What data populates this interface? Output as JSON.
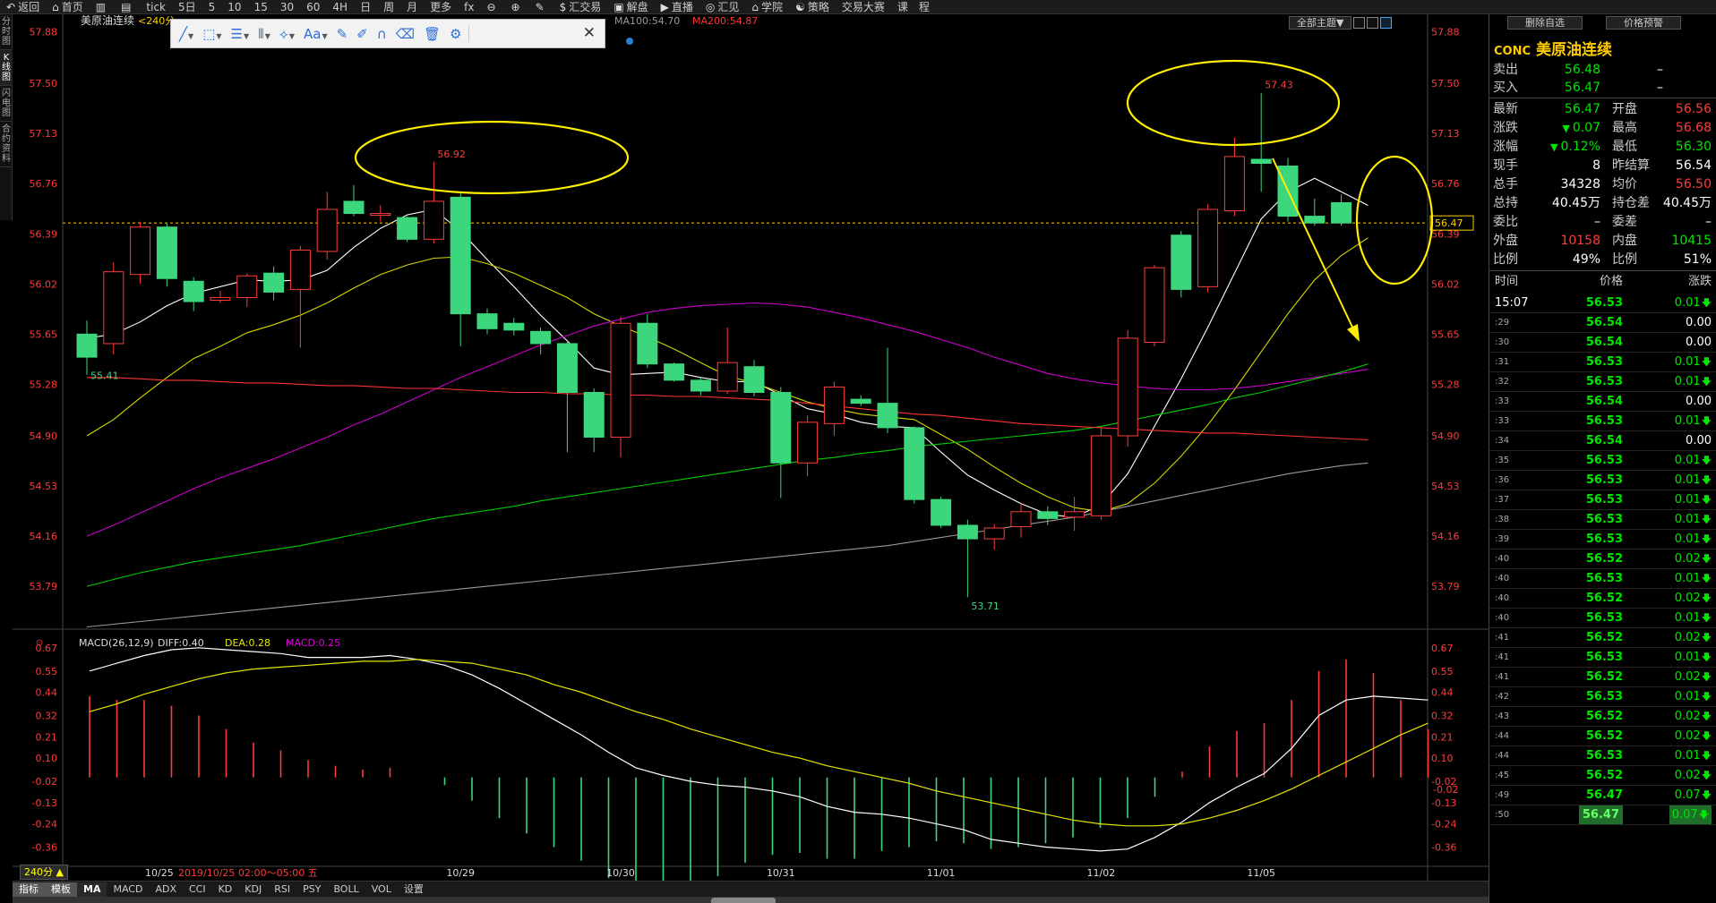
{
  "topbar": {
    "items": [
      "返回",
      "首页",
      "",
      "",
      "tick",
      "5日",
      "5",
      "10",
      "15",
      "30",
      "60",
      "4H",
      "日",
      "周",
      "月",
      "更多",
      "fx",
      "",
      "",
      "",
      "汇交易",
      "解盘",
      "直播",
      "汇见",
      "学院",
      "策略",
      "交易大赛",
      "课　程"
    ]
  },
  "left_tabs": [
    "分时图",
    "K线图",
    "闪电图",
    "合约资料"
  ],
  "chart_header": {
    "name": "美原油连续",
    "period_suffix": "<240分",
    "ma100": "MA100:54.70",
    "ma200": "MA200:54.87"
  },
  "topright": {
    "theme_button": "全部主题▼"
  },
  "macd_header": {
    "title": "MACD(26,12,9)",
    "diff": "DIFF:0.40",
    "dea": "DEA:0.28",
    "macd": "MACD:0.25"
  },
  "status_bar": {
    "period": "240分 ▲",
    "date_info": "2019/10/25 02:00～05:00 五",
    "first_date": "10/25"
  },
  "bottom_tabs": [
    "指标",
    "模板",
    "MA",
    "MACD",
    "ADX",
    "CCI",
    "KD",
    "KDJ",
    "RSI",
    "PSY",
    "BOLL",
    "VOL",
    "设置"
  ],
  "price_box": "56.47",
  "colors": {
    "up": "#ff3b3b",
    "down": "#3cd67d",
    "yellow_annot": "#ffee00",
    "ma_white": "#ffffff",
    "ma_yellow": "#d6d600",
    "ma_magenta": "#cc00cc",
    "ma_green": "#00cc00",
    "ma_red": "#ff3333",
    "ma_gray": "#999999"
  },
  "chart_data": [
    {
      "type": "candlestick",
      "title": "美原油连续",
      "y_ticks": [
        57.88,
        57.5,
        57.13,
        56.76,
        56.39,
        56.02,
        55.65,
        55.28,
        54.9,
        54.53,
        54.16,
        53.79
      ],
      "ylim": [
        53.52,
        57.93
      ],
      "x_date_labels": [
        "10/25",
        "10/29",
        "10/30",
        "10/31",
        "11/01",
        "11/02",
        "11/05"
      ],
      "x_label_bar_index": [
        0,
        14,
        20,
        26,
        32,
        38,
        44
      ],
      "current_price": 56.47,
      "annotations": [
        {
          "text": "56.92",
          "bar": 13,
          "value": 56.92
        },
        {
          "text": "57.43",
          "bar": 44,
          "value": 57.43
        },
        {
          "text": "53.71",
          "bar": 33,
          "value": 53.71
        },
        {
          "text": "55.41",
          "bar": 0,
          "value": 55.41
        }
      ],
      "candles": [
        [
          55.65,
          55.48,
          55.75,
          55.35
        ],
        [
          55.58,
          56.11,
          56.18,
          55.5
        ],
        [
          56.09,
          56.44,
          56.48,
          56.02
        ],
        [
          56.44,
          56.06,
          56.47,
          56.0
        ],
        [
          56.04,
          55.89,
          56.07,
          55.82
        ],
        [
          55.9,
          55.92,
          55.97,
          55.88
        ],
        [
          55.92,
          56.08,
          56.1,
          55.85
        ],
        [
          56.1,
          55.96,
          56.15,
          55.9
        ],
        [
          55.98,
          56.27,
          56.3,
          55.55
        ],
        [
          56.26,
          56.57,
          56.7,
          56.2
        ],
        [
          56.63,
          56.54,
          56.75,
          56.52
        ],
        [
          56.54,
          56.54,
          56.6,
          56.48
        ],
        [
          56.51,
          56.35,
          56.52,
          56.33
        ],
        [
          56.35,
          56.63,
          56.92,
          56.32
        ],
        [
          56.66,
          55.8,
          56.7,
          55.56
        ],
        [
          55.8,
          55.69,
          55.84,
          55.65
        ],
        [
          55.73,
          55.68,
          55.77,
          55.64
        ],
        [
          55.67,
          55.58,
          55.7,
          55.5
        ],
        [
          55.58,
          55.22,
          55.6,
          54.78
        ],
        [
          55.22,
          54.89,
          55.25,
          54.78
        ],
        [
          54.89,
          55.73,
          55.78,
          54.74
        ],
        [
          55.73,
          55.43,
          55.8,
          55.4
        ],
        [
          55.43,
          55.31,
          55.44,
          55.3
        ],
        [
          55.31,
          55.23,
          55.33,
          55.2
        ],
        [
          55.23,
          55.44,
          55.7,
          55.21
        ],
        [
          55.41,
          55.22,
          55.46,
          55.19
        ],
        [
          55.22,
          54.7,
          55.26,
          54.44
        ],
        [
          54.7,
          55.0,
          55.05,
          54.6
        ],
        [
          54.99,
          55.26,
          55.3,
          54.9
        ],
        [
          55.17,
          55.14,
          55.2,
          55.12
        ],
        [
          55.14,
          54.96,
          55.55,
          54.92
        ],
        [
          54.96,
          54.43,
          54.97,
          54.4
        ],
        [
          54.43,
          54.24,
          54.45,
          54.22
        ],
        [
          54.24,
          54.14,
          54.28,
          53.71
        ],
        [
          54.14,
          54.22,
          54.25,
          54.06
        ],
        [
          54.23,
          54.34,
          54.4,
          54.15
        ],
        [
          54.34,
          54.29,
          54.38,
          54.24
        ],
        [
          54.3,
          54.34,
          54.45,
          54.2
        ],
        [
          54.31,
          54.9,
          54.96,
          54.28
        ],
        [
          54.9,
          55.62,
          55.68,
          54.82
        ],
        [
          55.59,
          56.14,
          56.16,
          55.56
        ],
        [
          56.38,
          55.98,
          56.41,
          55.92
        ],
        [
          56.0,
          56.57,
          56.61,
          55.96
        ],
        [
          56.56,
          56.96,
          57.1,
          56.52
        ],
        [
          56.94,
          56.91,
          57.43,
          56.7
        ],
        [
          56.89,
          56.52,
          56.95,
          56.48
        ],
        [
          56.52,
          56.47,
          56.65,
          56.45
        ],
        [
          56.62,
          56.47,
          56.68,
          56.45
        ]
      ],
      "ma_series": [
        {
          "values": [
            55.62,
            55.65,
            55.74,
            55.86,
            55.95,
            56.0,
            56.05,
            56.04,
            56.05,
            56.12,
            56.29,
            56.43,
            56.53,
            56.57,
            56.41,
            56.2,
            56.0,
            55.79,
            55.6,
            55.4,
            55.35,
            55.36,
            55.37,
            55.33,
            55.3,
            55.3,
            55.2,
            55.1,
            55.06,
            55.0,
            54.97,
            54.96,
            54.78,
            54.61,
            54.5,
            54.4,
            54.32,
            54.3,
            54.39,
            54.62,
            54.97,
            55.32,
            55.7,
            56.1,
            56.5,
            56.7,
            56.8,
            56.7,
            56.6
          ]
        },
        {
          "values": [
            54.9,
            55.02,
            55.18,
            55.33,
            55.47,
            55.56,
            55.66,
            55.72,
            55.79,
            55.88,
            55.99,
            56.09,
            56.16,
            56.21,
            56.22,
            56.17,
            56.1,
            56.01,
            55.92,
            55.8,
            55.71,
            55.63,
            55.54,
            55.44,
            55.34,
            55.29,
            55.22,
            55.15,
            55.1,
            55.06,
            55.04,
            55.02,
            54.91,
            54.8,
            54.67,
            54.55,
            54.45,
            54.37,
            54.34,
            54.4,
            54.55,
            54.75,
            54.98,
            55.24,
            55.52,
            55.8,
            56.05,
            56.23,
            56.36
          ]
        },
        {
          "values": [
            54.16,
            54.24,
            54.33,
            54.42,
            54.51,
            54.59,
            54.66,
            54.73,
            54.81,
            54.89,
            54.98,
            55.06,
            55.15,
            55.24,
            55.33,
            55.41,
            55.49,
            55.57,
            55.64,
            55.71,
            55.76,
            55.81,
            55.84,
            55.86,
            55.87,
            55.88,
            55.87,
            55.85,
            55.81,
            55.77,
            55.72,
            55.67,
            55.61,
            55.55,
            55.48,
            55.42,
            55.36,
            55.32,
            55.29,
            55.27,
            55.25,
            55.24,
            55.24,
            55.25,
            55.27,
            55.3,
            55.33,
            55.36,
            55.39
          ]
        },
        {
          "values": [
            53.79,
            53.84,
            53.89,
            53.93,
            53.97,
            54.0,
            54.03,
            54.06,
            54.09,
            54.13,
            54.17,
            54.21,
            54.25,
            54.29,
            54.32,
            54.35,
            54.38,
            54.42,
            54.45,
            54.48,
            54.51,
            54.54,
            54.57,
            54.6,
            54.63,
            54.66,
            54.69,
            54.72,
            54.74,
            54.77,
            54.79,
            54.82,
            54.84,
            54.86,
            54.88,
            54.9,
            54.92,
            54.94,
            54.97,
            55.01,
            55.05,
            55.09,
            55.13,
            55.18,
            55.22,
            55.27,
            55.32,
            55.37,
            55.43
          ]
        },
        {
          "values": [
            55.33,
            55.33,
            55.32,
            55.31,
            55.31,
            55.3,
            55.29,
            55.29,
            55.28,
            55.27,
            55.27,
            55.26,
            55.25,
            55.25,
            55.24,
            55.23,
            55.22,
            55.22,
            55.21,
            55.21,
            55.2,
            55.2,
            55.19,
            55.19,
            55.18,
            55.17,
            55.16,
            55.14,
            55.12,
            55.1,
            55.08,
            55.06,
            55.05,
            55.03,
            55.01,
            54.99,
            54.98,
            54.97,
            54.96,
            54.95,
            54.94,
            54.93,
            54.92,
            54.92,
            54.91,
            54.9,
            54.89,
            54.88,
            54.87
          ]
        },
        {
          "values": [
            53.49,
            53.51,
            53.53,
            53.55,
            53.57,
            53.59,
            53.61,
            53.63,
            53.65,
            53.67,
            53.69,
            53.71,
            53.73,
            53.75,
            53.77,
            53.79,
            53.81,
            53.83,
            53.85,
            53.87,
            53.89,
            53.91,
            53.93,
            53.95,
            53.97,
            53.99,
            54.01,
            54.03,
            54.05,
            54.07,
            54.09,
            54.12,
            54.15,
            54.18,
            54.21,
            54.24,
            54.27,
            54.3,
            54.34,
            54.38,
            54.42,
            54.46,
            54.5,
            54.54,
            54.58,
            54.62,
            54.65,
            54.68,
            54.7
          ]
        }
      ]
    },
    {
      "type": "macd",
      "title": "MACD(26,12,9)",
      "y_ticks": [
        0.67,
        0.55,
        0.44,
        0.32,
        0.21,
        0.1,
        -0.02,
        -0.13,
        -0.24,
        -0.36
      ],
      "ylim": [
        -0.45,
        0.72
      ],
      "right_current_label": "-0.02",
      "diff": [
        0.55,
        0.59,
        0.63,
        0.66,
        0.67,
        0.66,
        0.65,
        0.64,
        0.62,
        0.62,
        0.62,
        0.63,
        0.61,
        0.58,
        0.53,
        0.46,
        0.38,
        0.3,
        0.22,
        0.13,
        0.05,
        0.01,
        -0.02,
        -0.04,
        -0.05,
        -0.07,
        -0.1,
        -0.15,
        -0.18,
        -0.19,
        -0.21,
        -0.24,
        -0.27,
        -0.32,
        -0.34,
        -0.36,
        -0.37,
        -0.38,
        -0.37,
        -0.31,
        -0.23,
        -0.13,
        -0.05,
        0.02,
        0.15,
        0.32,
        0.4,
        0.42,
        0.41,
        0.4
      ],
      "dea": [
        0.34,
        0.38,
        0.43,
        0.47,
        0.51,
        0.54,
        0.56,
        0.57,
        0.58,
        0.59,
        0.6,
        0.6,
        0.61,
        0.6,
        0.59,
        0.56,
        0.53,
        0.48,
        0.44,
        0.39,
        0.34,
        0.3,
        0.25,
        0.21,
        0.17,
        0.13,
        0.1,
        0.06,
        0.03,
        0.0,
        -0.03,
        -0.07,
        -0.1,
        -0.13,
        -0.16,
        -0.19,
        -0.22,
        -0.24,
        -0.25,
        -0.25,
        -0.24,
        -0.21,
        -0.17,
        -0.12,
        -0.06,
        0.01,
        0.08,
        0.15,
        0.22,
        0.28
      ],
      "macd_hist": [
        0.42,
        0.4,
        0.4,
        0.37,
        0.32,
        0.25,
        0.18,
        0.14,
        0.09,
        0.06,
        0.04,
        0.05,
        0.0,
        -0.04,
        -0.12,
        -0.21,
        -0.29,
        -0.36,
        -0.43,
        -0.52,
        -0.58,
        -0.58,
        -0.56,
        -0.51,
        -0.44,
        -0.4,
        -0.39,
        -0.42,
        -0.42,
        -0.38,
        -0.36,
        -0.33,
        -0.34,
        -0.37,
        -0.36,
        -0.34,
        -0.31,
        -0.26,
        -0.21,
        -0.1,
        0.03,
        0.16,
        0.24,
        0.28,
        0.4,
        0.55,
        0.61,
        0.54,
        0.4,
        0.25
      ]
    }
  ],
  "panel": {
    "code": "CONC",
    "name": "美原油连续",
    "buttons": [
      "删除自选",
      "价格预警"
    ],
    "bid_ask": [
      {
        "label": "卖出",
        "value": "56.48",
        "extra": "–"
      },
      {
        "label": "买入",
        "value": "56.47",
        "extra": "–"
      }
    ],
    "stats": [
      {
        "l1": "最新",
        "v1": "56.47",
        "c1": "green",
        "l2": "开盘",
        "v2": "56.56",
        "c2": "red"
      },
      {
        "l1": "涨跌",
        "v1": "0.07",
        "c1": "green",
        "l2": "最高",
        "v2": "56.68",
        "c2": "red"
      },
      {
        "l1": "涨幅",
        "v1": "0.12%",
        "c1": "green",
        "l2": "最低",
        "v2": "56.30",
        "c2": "green"
      },
      {
        "l1": "现手",
        "v1": "8",
        "c1": "white",
        "l2": "昨结算",
        "v2": "56.54",
        "c2": "white"
      },
      {
        "l1": "总手",
        "v1": "34328",
        "c1": "white",
        "l2": "均价",
        "v2": "56.50",
        "c2": "red"
      },
      {
        "l1": "总持",
        "v1": "40.45万",
        "c1": "white",
        "l2": "持仓差",
        "v2": "40.45万",
        "c2": "white"
      },
      {
        "l1": "委比",
        "v1": "–",
        "c1": "white",
        "l2": "委差",
        "v2": "–",
        "c2": "white"
      },
      {
        "l1": "外盘",
        "v1": "10158",
        "c1": "red",
        "l2": "内盘",
        "v2": "10415",
        "c2": "green"
      },
      {
        "l1": "比例",
        "v1": "49%",
        "c1": "white",
        "l2": "比例",
        "v2": "51%",
        "c2": "white"
      }
    ],
    "tick_header": {
      "time": "时间",
      "price": "价格",
      "change": "涨跌"
    },
    "ticks": [
      {
        "t": "15:07",
        "p": "56.53",
        "c": "0.01",
        "dir": "up"
      },
      {
        "t": ":29",
        "p": "56.54",
        "c": "0.00",
        "dir": "flat"
      },
      {
        "t": ":30",
        "p": "56.54",
        "c": "0.00",
        "dir": "flat"
      },
      {
        "t": ":31",
        "p": "56.53",
        "c": "0.01",
        "dir": "up"
      },
      {
        "t": ":32",
        "p": "56.53",
        "c": "0.01",
        "dir": "up"
      },
      {
        "t": ":33",
        "p": "56.54",
        "c": "0.00",
        "dir": "flat"
      },
      {
        "t": ":33",
        "p": "56.53",
        "c": "0.01",
        "dir": "up"
      },
      {
        "t": ":34",
        "p": "56.54",
        "c": "0.00",
        "dir": "flat"
      },
      {
        "t": ":35",
        "p": "56.53",
        "c": "0.01",
        "dir": "up"
      },
      {
        "t": ":36",
        "p": "56.53",
        "c": "0.01",
        "dir": "up"
      },
      {
        "t": ":37",
        "p": "56.53",
        "c": "0.01",
        "dir": "up"
      },
      {
        "t": ":38",
        "p": "56.53",
        "c": "0.01",
        "dir": "up"
      },
      {
        "t": ":39",
        "p": "56.53",
        "c": "0.01",
        "dir": "up"
      },
      {
        "t": ":40",
        "p": "56.52",
        "c": "0.02",
        "dir": "up"
      },
      {
        "t": ":40",
        "p": "56.53",
        "c": "0.01",
        "dir": "up"
      },
      {
        "t": ":40",
        "p": "56.52",
        "c": "0.02",
        "dir": "up"
      },
      {
        "t": ":40",
        "p": "56.53",
        "c": "0.01",
        "dir": "up"
      },
      {
        "t": ":41",
        "p": "56.52",
        "c": "0.02",
        "dir": "up"
      },
      {
        "t": ":41",
        "p": "56.53",
        "c": "0.01",
        "dir": "up"
      },
      {
        "t": ":41",
        "p": "56.52",
        "c": "0.02",
        "dir": "up"
      },
      {
        "t": ":42",
        "p": "56.53",
        "c": "0.01",
        "dir": "up"
      },
      {
        "t": ":43",
        "p": "56.52",
        "c": "0.02",
        "dir": "up"
      },
      {
        "t": ":44",
        "p": "56.52",
        "c": "0.02",
        "dir": "up"
      },
      {
        "t": ":44",
        "p": "56.53",
        "c": "0.01",
        "dir": "up"
      },
      {
        "t": ":45",
        "p": "56.52",
        "c": "0.02",
        "dir": "up"
      },
      {
        "t": ":49",
        "p": "56.47",
        "c": "0.07",
        "dir": "up"
      },
      {
        "t": ":50",
        "p": "56.47",
        "c": "0.07",
        "dir": "up"
      }
    ]
  }
}
